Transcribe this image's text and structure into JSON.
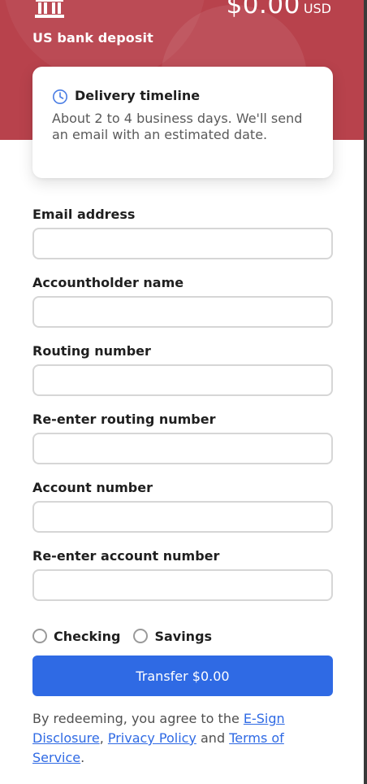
{
  "header": {
    "deposit_label": "US bank deposit",
    "amount": "$0.00",
    "currency": "USD",
    "background_color": "#b8424c"
  },
  "timeline": {
    "title": "Delivery timeline",
    "text": "About 2 to 4 business days. We'll send an email with an estimated date."
  },
  "form": {
    "fields": [
      {
        "label": "Email address",
        "value": ""
      },
      {
        "label": "Accountholder name",
        "value": ""
      },
      {
        "label": "Routing number",
        "value": ""
      },
      {
        "label": "Re-enter routing number",
        "value": ""
      },
      {
        "label": "Account number",
        "value": ""
      },
      {
        "label": "Re-enter account number",
        "value": ""
      }
    ],
    "account_types": [
      "Checking",
      "Savings"
    ]
  },
  "actions": {
    "transfer_label": "Transfer $0.00",
    "accent_color": "#2f6ae4"
  },
  "legal": {
    "prefix": "By redeeming, you agree to the ",
    "esign": "E-Sign Disclosure",
    "sep1": ", ",
    "privacy": "Privacy Policy",
    "and": " and ",
    "terms": "Terms of Service",
    "suffix": "."
  },
  "icons": {
    "bank": "bank-icon",
    "clock": "clock-icon"
  }
}
